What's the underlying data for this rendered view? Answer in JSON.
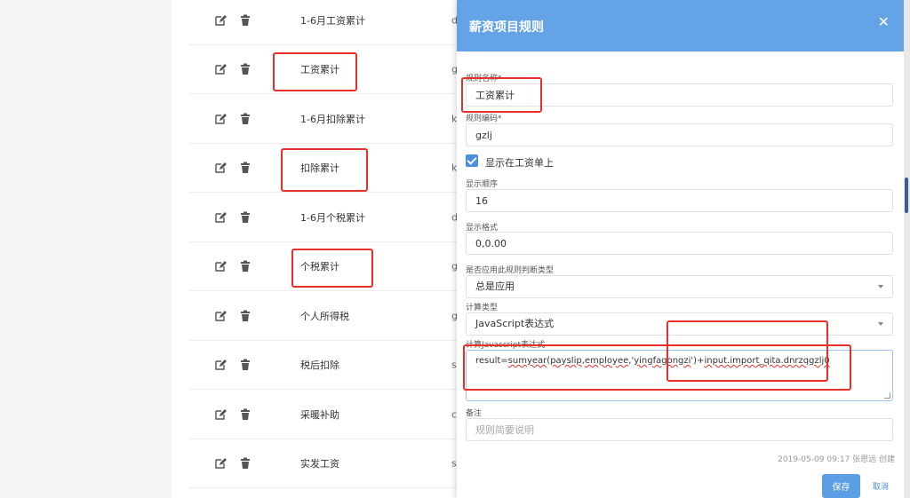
{
  "list": {
    "rows": [
      {
        "name": "1-6月工资累计",
        "code": "d"
      },
      {
        "name": "工资累计",
        "code": "g"
      },
      {
        "name": "1-6月扣除累计",
        "code": "k"
      },
      {
        "name": "扣除累计",
        "code": "k"
      },
      {
        "name": "1-6月个税累计",
        "code": "d"
      },
      {
        "name": "个税累计",
        "code": "g"
      },
      {
        "name": "个人所得税",
        "code": "g"
      },
      {
        "name": "税后扣除",
        "code": "s"
      },
      {
        "name": "采暖补助",
        "code": "c"
      },
      {
        "name": "实发工资",
        "code": "s"
      }
    ]
  },
  "modal": {
    "title": "薪资项目规则",
    "close_icon": "close-icon",
    "rule_name_label": "规则名称*",
    "rule_name_value": "工资累计",
    "rule_code_label": "规则编码*",
    "rule_code_value": "gzlj",
    "show_on_payslip_label": "显示在工资单上",
    "display_order_label": "显示顺序",
    "display_order_value": "16",
    "display_format_label": "显示格式",
    "display_format_value": "0,0.00",
    "apply_type_label": "是否应用此规则判断类型",
    "apply_type_value": "总是应用",
    "calc_type_label": "计算类型",
    "calc_type_value": "JavaScript表达式",
    "js_expr_label": "计算Javascript表达式",
    "js_expr_part1": "result=",
    "js_expr_spell1": "sumyear",
    "js_expr_part2": "(",
    "js_expr_spell2": "payslip",
    "js_expr_part3": ",",
    "js_expr_spell3": "employee",
    "js_expr_part4": ",'",
    "js_expr_spell4": "yingfagongzi",
    "js_expr_part5": "')+",
    "js_expr_spell5": "input.import_qita.dnrzqgzlj0",
    "remark_label": "备注",
    "remark_placeholder": "规则简要说明",
    "audit_text": "2019-05-09 09:17 张恩远 创建",
    "save_label": "保存",
    "cancel_label": "取消"
  },
  "colors": {
    "header": "#63a3e6",
    "primary": "#5b9ee6",
    "annotation": "#e8302a"
  }
}
